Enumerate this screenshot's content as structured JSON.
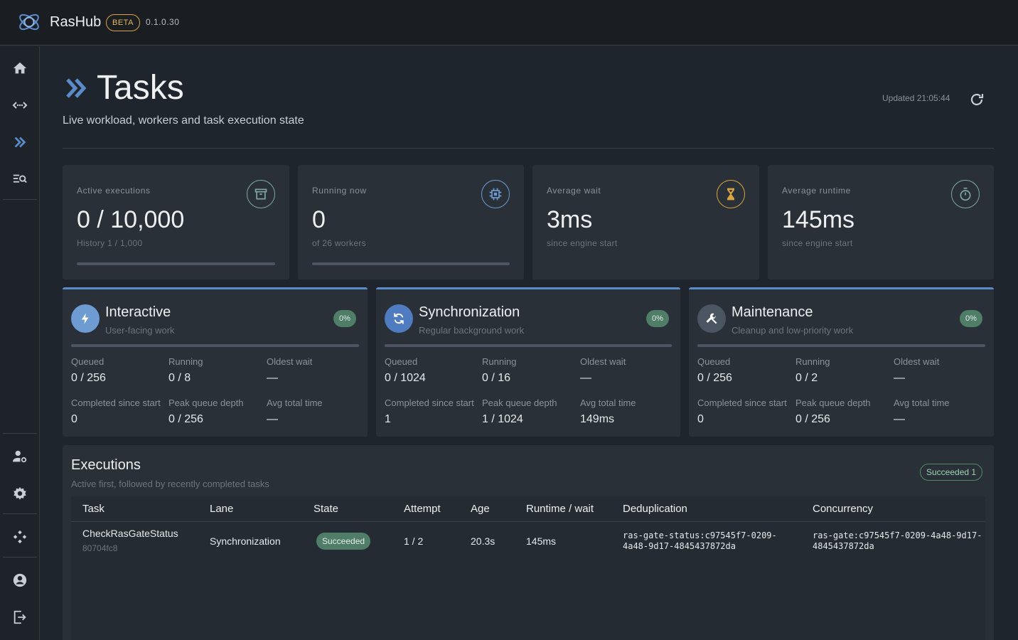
{
  "app": {
    "name": "RasHub",
    "badge": "BETA",
    "version": "0.1.0.30"
  },
  "sidebar": {
    "items": [
      {
        "icon": "home-icon"
      },
      {
        "icon": "code-arrows-icon"
      },
      {
        "icon": "double-chevron-icon"
      },
      {
        "icon": "search-list-icon"
      },
      {
        "icon": "user-settings-icon"
      },
      {
        "icon": "gear-icon"
      },
      {
        "icon": "network-icon"
      },
      {
        "icon": "account-icon"
      },
      {
        "icon": "logout-icon"
      }
    ]
  },
  "header": {
    "title": "Tasks",
    "subtitle": "Live workload, workers and task execution state",
    "updated": "Updated 21:05:44"
  },
  "stats": [
    {
      "label": "Active executions",
      "value": "0 / 10,000",
      "sub": "History 1 / 1,000",
      "icon": "archive-icon",
      "color": "#7fa9a0",
      "progress": 0
    },
    {
      "label": "Running now",
      "value": "0",
      "sub": "of 26 workers",
      "icon": "cpu-icon",
      "color": "#6e9bd1",
      "progress": 0
    },
    {
      "label": "Average wait",
      "value": "3ms",
      "sub": "since engine start",
      "icon": "hourglass-icon",
      "color": "#d9a441"
    },
    {
      "label": "Average runtime",
      "value": "145ms",
      "sub": "since engine start",
      "icon": "stopwatch-icon",
      "color": "#7fa9a0"
    }
  ],
  "lanes": [
    {
      "name": "Interactive",
      "desc": "User-facing work",
      "pct": "0%",
      "icon": "bolt-icon",
      "icon_bg": "#6e9bd1",
      "metrics": [
        {
          "label": "Queued",
          "value": "0 / 256"
        },
        {
          "label": "Running",
          "value": "0 / 8"
        },
        {
          "label": "Oldest wait",
          "value": "—"
        },
        {
          "label": "Completed since start",
          "value": "0"
        },
        {
          "label": "Peak queue depth",
          "value": "0 / 256"
        },
        {
          "label": "Avg total time",
          "value": "—"
        }
      ]
    },
    {
      "name": "Synchronization",
      "desc": "Regular background work",
      "pct": "0%",
      "icon": "sync-icon",
      "icon_bg": "#4f7cc0",
      "metrics": [
        {
          "label": "Queued",
          "value": "0 / 1024"
        },
        {
          "label": "Running",
          "value": "0 / 16"
        },
        {
          "label": "Oldest wait",
          "value": "—"
        },
        {
          "label": "Completed since start",
          "value": "1"
        },
        {
          "label": "Peak queue depth",
          "value": "1 / 1024"
        },
        {
          "label": "Avg total time",
          "value": "149ms"
        }
      ]
    },
    {
      "name": "Maintenance",
      "desc": "Cleanup and low-priority work",
      "pct": "0%",
      "icon": "wrench-icon",
      "icon_bg": "#4c5663",
      "metrics": [
        {
          "label": "Queued",
          "value": "0 / 256"
        },
        {
          "label": "Running",
          "value": "0 / 2"
        },
        {
          "label": "Oldest wait",
          "value": "—"
        },
        {
          "label": "Completed since start",
          "value": "0"
        },
        {
          "label": "Peak queue depth",
          "value": "0 / 256"
        },
        {
          "label": "Avg total time",
          "value": "—"
        }
      ]
    }
  ],
  "executions": {
    "title": "Executions",
    "subtitle": "Active first, followed by recently completed tasks",
    "badge": "Succeeded 1",
    "columns": [
      "Task",
      "Lane",
      "State",
      "Attempt",
      "Age",
      "Runtime / wait",
      "Deduplication",
      "Concurrency"
    ],
    "rows": [
      {
        "task": "CheckRasGateStatus",
        "id": "80704fc8",
        "lane": "Synchronization",
        "state": "Succeeded",
        "attempt": "1 / 2",
        "age": "20.3s",
        "runtime": "145ms",
        "dedup": "ras-gate-status:c97545f7-0209-4a48-9d17-4845437872da",
        "concurrency": "ras-gate:c97545f7-0209-4a48-9d17-4845437872da"
      }
    ]
  }
}
